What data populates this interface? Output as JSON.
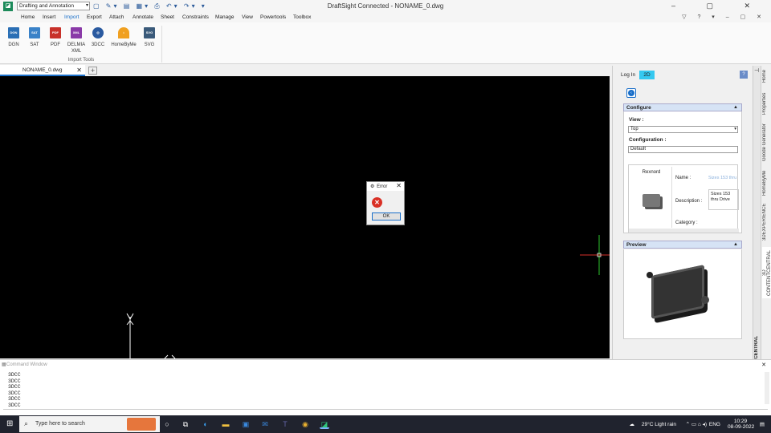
{
  "titlebar": {
    "workspace": "Drafting and Annotation",
    "title": "DraftSight Connected - NONAME_0.dwg"
  },
  "menu": [
    "Home",
    "Insert",
    "Import",
    "Export",
    "Attach",
    "Annotate",
    "Sheet",
    "Constraints",
    "Manage",
    "View",
    "Powertools",
    "Toolbox"
  ],
  "menu_active": "Import",
  "ribbon": {
    "buttons": [
      {
        "label": "DGN",
        "icon": "dgn-file-icon",
        "color": "#2a6fb5"
      },
      {
        "label": "SAT",
        "icon": "sat-file-icon",
        "color": "#3a82c8"
      },
      {
        "label": "PDF",
        "icon": "pdf-file-icon",
        "color": "#c8312a"
      },
      {
        "label": "DELMIA XML",
        "icon": "delmia-xml-icon",
        "color": "#8a3aa8"
      },
      {
        "label": "3DCC",
        "icon": "3dcc-globe-icon",
        "color": "#2a5aa0"
      },
      {
        "label": "HomeByMe",
        "icon": "homebyme-icon",
        "color": "#f0a020"
      },
      {
        "label": "SVG",
        "icon": "svg-file-icon",
        "color": "#3a5a7a"
      }
    ],
    "group_label": "Import Tools"
  },
  "document_tab": "NONAME_0.dwg",
  "dialog": {
    "title": "Error",
    "ok": "OK"
  },
  "right_panel": {
    "login": "Log In",
    "mode": "2D",
    "configure": {
      "title": "Configure",
      "view_label": "View :",
      "view_value": "Top",
      "config_label": "Configuration :",
      "config_value": "Default",
      "item_name": "Rexnord",
      "name_label": "Name :",
      "name_value": "Sizes 153 thru",
      "description_label": "Description :",
      "description_value": "Sizes 153 thru Drive",
      "category_label": "Category :"
    },
    "preview": {
      "title": "Preview"
    }
  },
  "side_tabs": [
    "Home",
    "Properties",
    "Goode Generator",
    "HomeByMe",
    "3DEXPERIENCE",
    "3D CONTENTCENTRAL"
  ],
  "edge_label": "CENTRAL",
  "command_window": {
    "title": "Command Window",
    "lines": [
      "3DCC",
      "3DCC",
      "3DCC",
      "3DCC",
      "3DCC",
      "3DCC"
    ]
  },
  "taskbar": {
    "search_placeholder": "Type here to search",
    "weather": "29°C  Light rain",
    "language": "ENG",
    "time": "10:29",
    "date": "08-09-2022"
  }
}
